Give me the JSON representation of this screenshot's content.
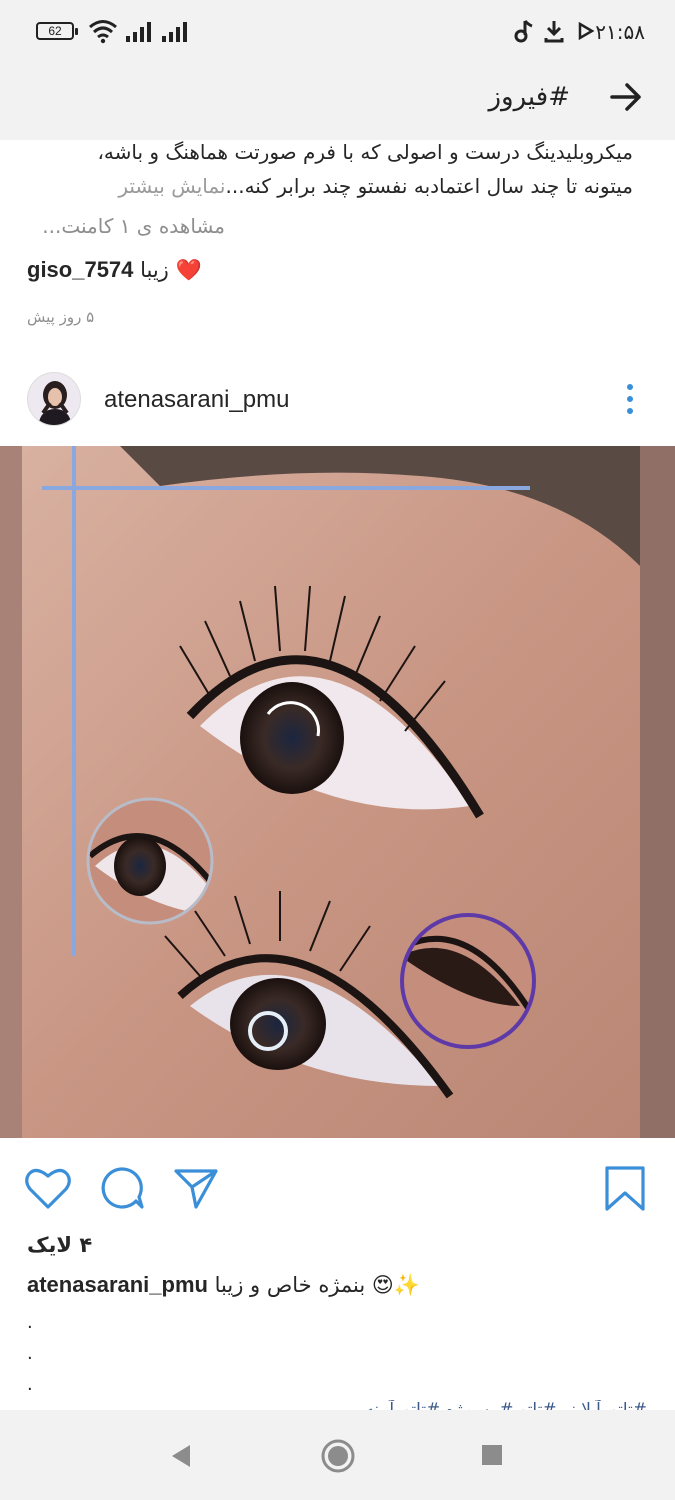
{
  "status_bar": {
    "battery": "62",
    "time": "۲۱:۵۸"
  },
  "header": {
    "title": "#فیروز"
  },
  "prev_post": {
    "caption_line1": "میکروبلیدینگ درست و اصولی که با فرم صورتت هماهنگ و باشه،",
    "caption_line2_main": "میتونه تا چند سال اعتمادبه نفستو چند برابر کنه...",
    "caption_line2_more": "نمایش بیشتر",
    "view_comments": "مشاهده ی ۱ کامنت...",
    "comment_user": "giso_7574",
    "comment_text": "زیبا",
    "comment_emoji": "❤️",
    "time_ago": "۵ روز پیش"
  },
  "post": {
    "username": "atenasarani_pmu",
    "likes": "۴ لایک",
    "caption_user": "atenasarani_pmu",
    "caption_text": "بنمژه خاص و زیبا",
    "caption_emojis": "😍✨",
    "dots": [
      ".",
      ".",
      "."
    ],
    "hashtags_partial": "#تاتو_آیلاینر #تاتو #بن_مژه #تاتو_آیینه"
  },
  "icons": {
    "like": "heart-icon",
    "comment": "comment-bubble-icon",
    "share": "paper-plane-icon",
    "save": "bookmark-icon",
    "back": "arrow-right-icon",
    "more": "vertical-dots-icon"
  },
  "colors": {
    "accent": "#3b8fd9",
    "bar_bg": "#f2f2f2"
  }
}
